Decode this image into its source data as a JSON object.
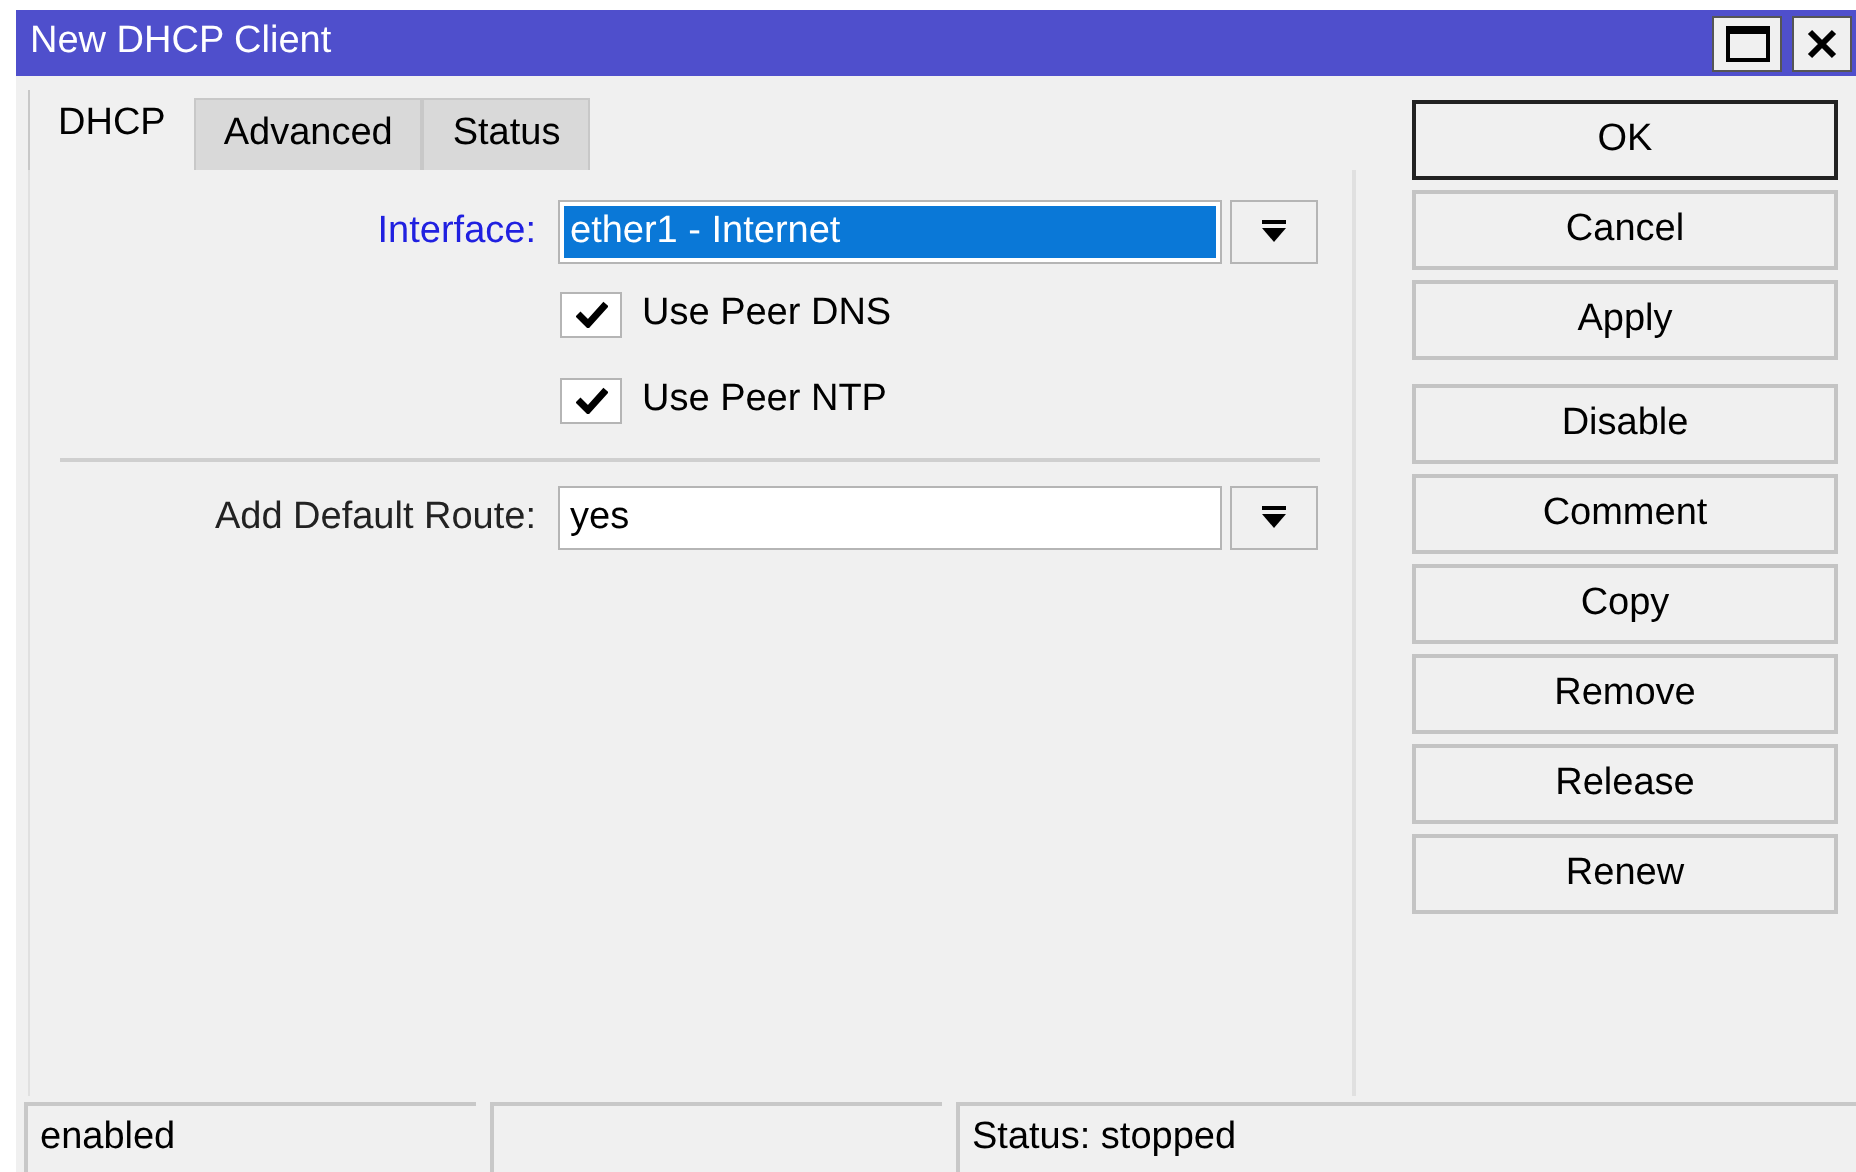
{
  "window": {
    "title": "New DHCP Client"
  },
  "tabs": [
    {
      "label": "DHCP",
      "selected": true
    },
    {
      "label": "Advanced",
      "selected": false
    },
    {
      "label": "Status",
      "selected": false
    }
  ],
  "interface": {
    "label": "Interface:",
    "value": "ether1 - Internet",
    "selected": true
  },
  "checkboxes": [
    {
      "label": "Use Peer DNS",
      "checked": true
    },
    {
      "label": "Use Peer NTP",
      "checked": true
    }
  ],
  "add_default_route": {
    "label": "Add Default Route:",
    "value": "yes",
    "selected": false
  },
  "button_groups": [
    {
      "buttons": [
        {
          "label": "OK",
          "default": true
        },
        {
          "label": "Cancel",
          "default": false
        },
        {
          "label": "Apply",
          "default": false
        }
      ]
    },
    {
      "buttons": [
        {
          "label": "Disable",
          "default": false
        },
        {
          "label": "Comment",
          "default": false
        },
        {
          "label": "Copy",
          "default": false
        },
        {
          "label": "Remove",
          "default": false
        },
        {
          "label": "Release",
          "default": false
        },
        {
          "label": "Renew",
          "default": false
        }
      ]
    }
  ],
  "status_bar": {
    "left": "enabled",
    "right": "Status: stopped"
  }
}
